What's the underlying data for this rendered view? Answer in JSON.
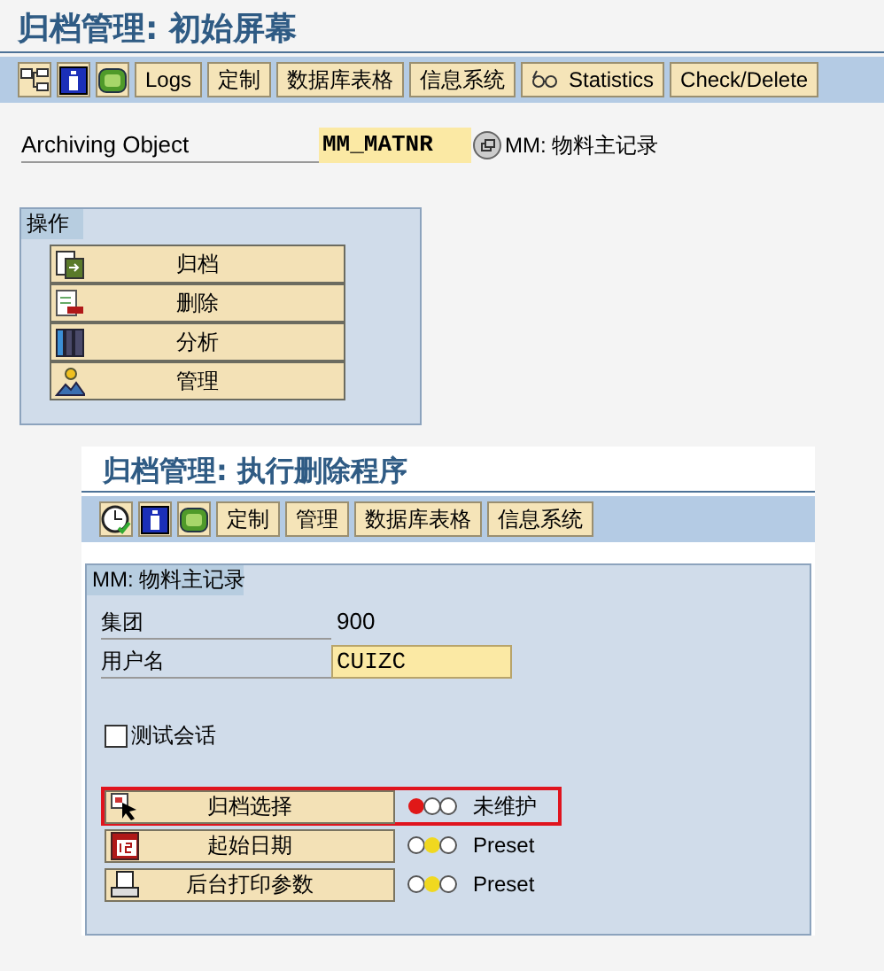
{
  "screen_1": {
    "title": "归档管理: 初始屏幕",
    "toolbar": [
      {
        "kind": "tree"
      },
      {
        "kind": "info"
      },
      {
        "kind": "job"
      },
      {
        "kind": "text",
        "label": "Logs"
      },
      {
        "kind": "text",
        "label": "定制"
      },
      {
        "kind": "text",
        "label": "数据库表格"
      },
      {
        "kind": "text",
        "label": "信息系统"
      },
      {
        "kind": "glasses",
        "label": "Statistics"
      },
      {
        "kind": "text",
        "label": "Check/Delete"
      }
    ],
    "archiving_object": {
      "label": "Archiving Object",
      "value": "MM_MATNR",
      "description": "MM: 物料主记录"
    },
    "actions_group": {
      "title": "操作",
      "buttons": [
        {
          "kind": "archive",
          "label": "归档"
        },
        {
          "kind": "delete",
          "label": "删除"
        },
        {
          "kind": "analyze",
          "label": "分析"
        },
        {
          "kind": "manage",
          "label": "管理"
        }
      ]
    }
  },
  "screen_2": {
    "title": "归档管理: 执行删除程序",
    "toolbar": [
      {
        "kind": "clock"
      },
      {
        "kind": "info"
      },
      {
        "kind": "job"
      },
      {
        "kind": "text",
        "label": "定制"
      },
      {
        "kind": "text",
        "label": "管理"
      },
      {
        "kind": "text",
        "label": "数据库表格"
      },
      {
        "kind": "text",
        "label": "信息系统"
      }
    ],
    "group": {
      "title": "MM: 物料主记录",
      "fields": [
        {
          "label": "集团",
          "value": "900",
          "editable": false
        },
        {
          "label": "用户名",
          "value": "CUIZC",
          "editable": true
        }
      ],
      "test_session": {
        "label": "测试会话",
        "checked": false
      },
      "steps": [
        {
          "kind": "select",
          "label": "归档选择",
          "light": {
            "kind": "stop",
            "color": "#e01818"
          },
          "status_text": "未维护",
          "highlighted": true
        },
        {
          "kind": "calendar",
          "label": "起始日期",
          "light": {
            "kind": "warning",
            "color": "#f0d820"
          },
          "status_text": "Preset",
          "highlighted": false
        },
        {
          "kind": "print",
          "label": "后台打印参数",
          "light": {
            "kind": "warning",
            "color": "#f0d820"
          },
          "status_text": "Preset",
          "highlighted": false
        }
      ]
    }
  }
}
